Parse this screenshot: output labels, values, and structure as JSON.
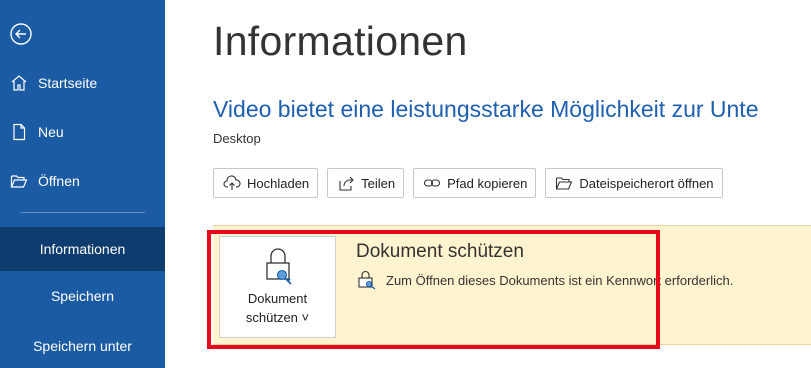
{
  "sidebar": {
    "back_icon": "back-arrow-icon",
    "items": [
      {
        "label": "Startseite",
        "icon": "home-icon"
      },
      {
        "label": "Neu",
        "icon": "new-document-icon"
      },
      {
        "label": "Öffnen",
        "icon": "folder-open-icon"
      },
      {
        "label": "Informationen",
        "active": true
      },
      {
        "label": "Speichern"
      },
      {
        "label": "Speichern unter"
      }
    ],
    "accent_color": "#1b5ba3",
    "active_color": "#0e3c6e"
  },
  "main": {
    "title": "Informationen",
    "document_title": "Video bietet eine leistungsstarke Möglichkeit zur Unte",
    "location": "Desktop",
    "toolbar": [
      {
        "label": "Hochladen",
        "icon": "cloud-upload-icon"
      },
      {
        "label": "Teilen",
        "icon": "share-icon"
      },
      {
        "label": "Pfad kopieren",
        "icon": "link-icon"
      },
      {
        "label": "Dateispeicherort öffnen",
        "icon": "folder-icon"
      }
    ]
  },
  "protect": {
    "button_line1": "Dokument",
    "button_line2": "schützen ˅",
    "heading": "Dokument schützen",
    "description": "Zum Öffnen dieses Dokuments ist ein Kennwort erforderlich.",
    "panel_color": "#fff4cf",
    "highlight_color": "#e8081b"
  }
}
